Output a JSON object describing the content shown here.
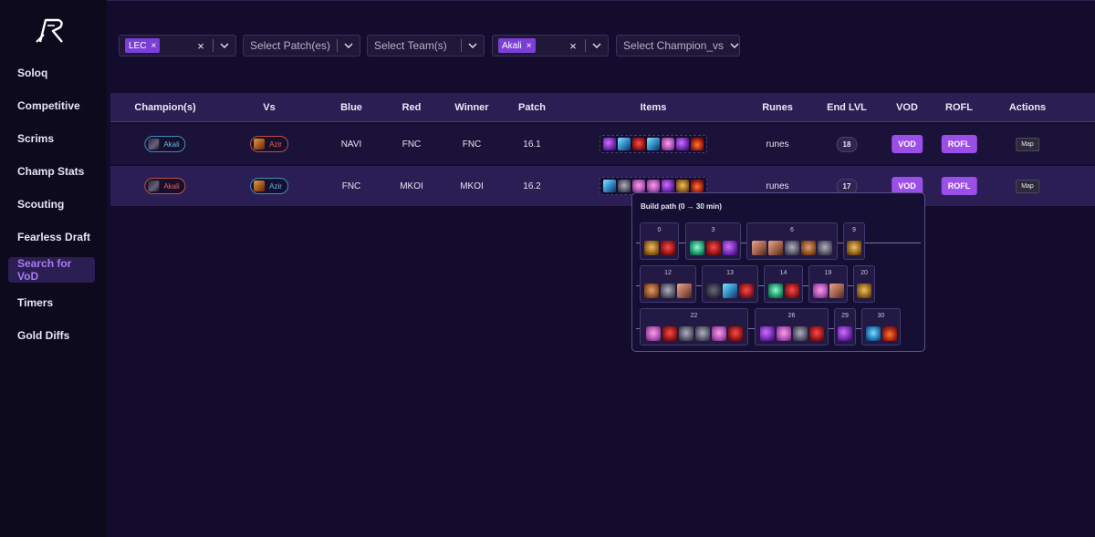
{
  "sidebar": {
    "logo_icon": "r-logo-icon",
    "items": [
      {
        "label": "Soloq",
        "active": false
      },
      {
        "label": "Competitive",
        "active": false
      },
      {
        "label": "Scrims",
        "active": false
      },
      {
        "label": "Champ Stats",
        "active": false
      },
      {
        "label": "Scouting",
        "active": false
      },
      {
        "label": "Fearless Draft",
        "active": false
      },
      {
        "label": "Search for VoD",
        "active": true
      },
      {
        "label": "Timers",
        "active": false
      },
      {
        "label": "Gold Diffs",
        "active": false
      }
    ]
  },
  "filters": {
    "league": {
      "chip": "LEC",
      "chip_remove": "×",
      "clear": "×"
    },
    "patch": {
      "placeholder": "Select Patch(es)"
    },
    "team": {
      "placeholder": "Select Team(s)"
    },
    "champion": {
      "chip": "Akali",
      "chip_remove": "×",
      "clear": "×"
    },
    "champion_vs": {
      "placeholder": "Select Champion_vs"
    }
  },
  "table": {
    "headers": [
      "Champion(s)",
      "Vs",
      "Blue",
      "Red",
      "Winner",
      "Patch",
      "Items",
      "Runes",
      "End LVL",
      "VOD",
      "ROFL",
      "Actions"
    ],
    "rows": [
      {
        "champion": "Akali",
        "champion_side": "blue",
        "vs": "Azir",
        "vs_side": "red",
        "blue": "NAVI",
        "red": "FNC",
        "winner": "FNC",
        "patch": "16.1",
        "items": [
          "i-void",
          "i-blade",
          "i-red",
          "i-blade",
          "i-pink",
          "i-void",
          "i-lava"
        ],
        "runes": "runes",
        "end_lvl": "18",
        "vod": "VOD",
        "rofl": "ROFL",
        "action": "Map"
      },
      {
        "champion": "Akali",
        "champion_side": "red",
        "vs": "Azir",
        "vs_side": "blue",
        "blue": "FNC",
        "red": "MKOI",
        "winner": "MKOI",
        "patch": "16.2",
        "items": [
          "i-blade",
          "i-grey",
          "i-pink",
          "i-pink",
          "i-void",
          "i-gold",
          "i-lava"
        ],
        "runes": "runes",
        "end_lvl": "17",
        "vod": "VOD",
        "rofl": "ROFL",
        "action": "Map"
      }
    ]
  },
  "build_path": {
    "title": "Build path (0 → 30 min)",
    "rows": [
      [
        {
          "time": "0",
          "items": [
            "i-gold",
            "i-red"
          ]
        },
        {
          "time": "3",
          "items": [
            "i-teal",
            "i-red",
            "i-void"
          ]
        },
        {
          "time": "6",
          "items": [
            "i-book",
            "i-book",
            "i-grey",
            "i-brown",
            "i-grey"
          ]
        },
        {
          "time": "9",
          "items": [
            "i-gold"
          ]
        }
      ],
      [
        {
          "time": "12",
          "items": [
            "i-brown",
            "i-grey",
            "i-book"
          ]
        },
        {
          "time": "13",
          "items": [
            "i-orb",
            "i-blade",
            "i-red"
          ]
        },
        {
          "time": "14",
          "items": [
            "i-teal",
            "i-red"
          ]
        },
        {
          "time": "19",
          "items": [
            "i-pink",
            "i-book"
          ]
        },
        {
          "time": "20",
          "items": [
            "i-gold"
          ]
        }
      ],
      [
        {
          "time": "22",
          "items": [
            "i-pink",
            "i-red",
            "i-grey",
            "i-grey",
            "i-pink",
            "i-red"
          ]
        },
        {
          "time": "26",
          "items": [
            "i-void",
            "i-pink",
            "i-grey",
            "i-red"
          ]
        },
        {
          "time": "29",
          "items": [
            "i-void"
          ]
        },
        {
          "time": "30",
          "items": [
            "i-bluegem",
            "i-lava"
          ]
        }
      ]
    ]
  },
  "colors": {
    "accent": "#9b4fe8",
    "background": "#130c2c",
    "sidebar": "#0d0a1e",
    "blue_side": "#5fb9e6",
    "red_side": "#f0614a"
  }
}
